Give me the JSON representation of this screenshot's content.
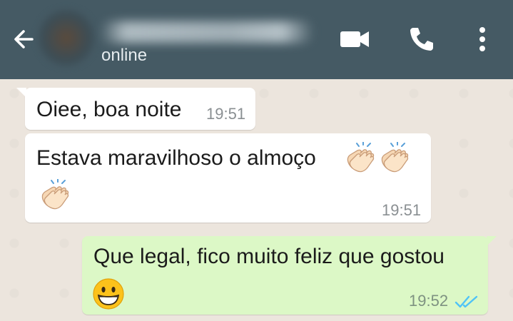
{
  "header": {
    "contact_name": "",
    "status": "online",
    "icons": [
      "back-arrow-icon",
      "video-call-icon",
      "phone-icon",
      "more-options-icon"
    ],
    "background_color": "#455a64"
  },
  "messages": [
    {
      "direction": "incoming",
      "text": "Oiee, boa noite",
      "time": "19:51",
      "emojis": []
    },
    {
      "direction": "incoming",
      "text": "Estava maravilhoso o almoço",
      "time": "19:51",
      "emojis": [
        "clapping-hands-icon",
        "clapping-hands-icon",
        "clapping-hands-icon"
      ]
    },
    {
      "direction": "outgoing",
      "text": "Que legal, fico muito feliz que gostou",
      "time": "19:52",
      "emojis": [
        "grinning-face-icon"
      ],
      "receipt": "read-double-check-icon"
    }
  ],
  "colors": {
    "chat_background": "#ece5dd",
    "incoming_bubble": "#ffffff",
    "outgoing_bubble": "#dcf8c6",
    "read_tick": "#4fc3f7"
  }
}
